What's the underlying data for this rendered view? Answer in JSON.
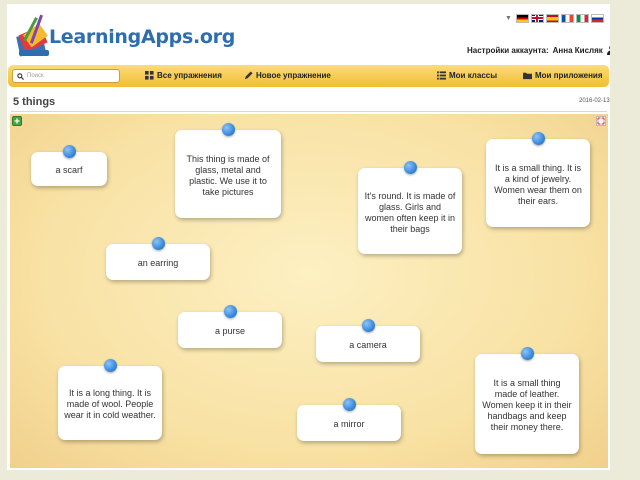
{
  "header": {
    "logo_text": "LearningApps.org",
    "account_label": "Настройки аккаунта:",
    "account_user": "Анна Кисляк"
  },
  "languages": [
    {
      "name": "German",
      "icon": "flag-de-icon",
      "colors": [
        "#000000",
        "#dd0000",
        "#ffce00"
      ]
    },
    {
      "name": "English",
      "icon": "flag-gb-icon",
      "colors": [
        "#012169",
        "#ffffff",
        "#c8102e"
      ]
    },
    {
      "name": "Spanish",
      "icon": "flag-es-icon",
      "colors": [
        "#c60b1e",
        "#ffc400",
        "#c60b1e"
      ]
    },
    {
      "name": "French",
      "icon": "flag-fr-icon",
      "colors": [
        "#0055a4",
        "#ffffff",
        "#ef4135"
      ]
    },
    {
      "name": "Italian",
      "icon": "flag-it-icon",
      "colors": [
        "#009246",
        "#ffffff",
        "#ce2b37"
      ]
    },
    {
      "name": "Russian",
      "icon": "flag-ru-icon",
      "colors": [
        "#ffffff",
        "#0039a6",
        "#d52b1e"
      ]
    }
  ],
  "nav": {
    "search_placeholder": "Поиск",
    "all_exercises": "Все упражнения",
    "new_exercise": "Новое упражнение",
    "my_classes": "Мои классы",
    "my_apps": "Мои приложения"
  },
  "page": {
    "title": "5 things",
    "date": "2016-02-13"
  },
  "cards": [
    {
      "text": "a scarf"
    },
    {
      "text": "This thing is made of glass, metal and plastic. We use it to take pictures"
    },
    {
      "text": "It's round. It is made of glass. Girls and women often keep it in their bags"
    },
    {
      "text": "It is a small thing. It is a kind of jewelry. Women wear them on their ears."
    },
    {
      "text": "an earring"
    },
    {
      "text": "a purse"
    },
    {
      "text": "a camera"
    },
    {
      "text": "It is a long thing. It is made of wool. People wear it in cold weather."
    },
    {
      "text": "a mirror"
    },
    {
      "text": "It is a small thing made of leather. Women keep it in their handbags and keep their money there."
    }
  ],
  "colors": {
    "accent_blue": "#2d6fae",
    "nav_gold": "#f1bd33",
    "board_cream": "#f8e1a3",
    "pin_blue": "#3f8ee0"
  }
}
